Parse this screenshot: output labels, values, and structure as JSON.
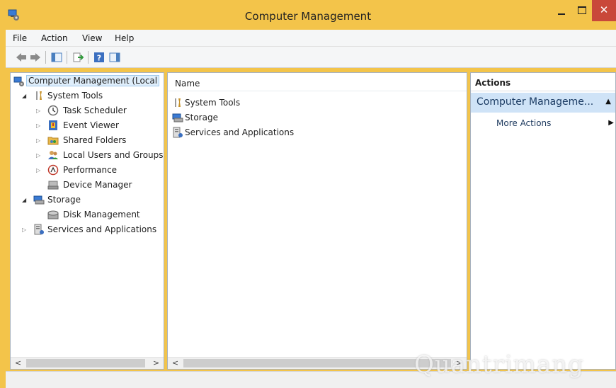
{
  "window": {
    "title": "Computer Management",
    "close_glyph": "✕"
  },
  "menu": [
    "File",
    "Action",
    "View",
    "Help"
  ],
  "tree": {
    "root": "Computer Management (Local",
    "system_tools": "System Tools",
    "task_scheduler": "Task Scheduler",
    "event_viewer": "Event Viewer",
    "shared_folders": "Shared Folders",
    "local_users": "Local Users and Groups",
    "performance": "Performance",
    "device_manager": "Device Manager",
    "storage": "Storage",
    "disk_management": "Disk Management",
    "services": "Services and Applications"
  },
  "list": {
    "column": "Name",
    "items": [
      "System Tools",
      "Storage",
      "Services and Applications"
    ]
  },
  "actions": {
    "header": "Actions",
    "group": "Computer Manageme...",
    "more": "More Actions"
  },
  "watermark": "Quantrimang",
  "colors": {
    "titlebar": "#f3c44a",
    "close": "#c9483a",
    "selection": "#dfeefb",
    "actions_group": "#cfe3f7"
  }
}
